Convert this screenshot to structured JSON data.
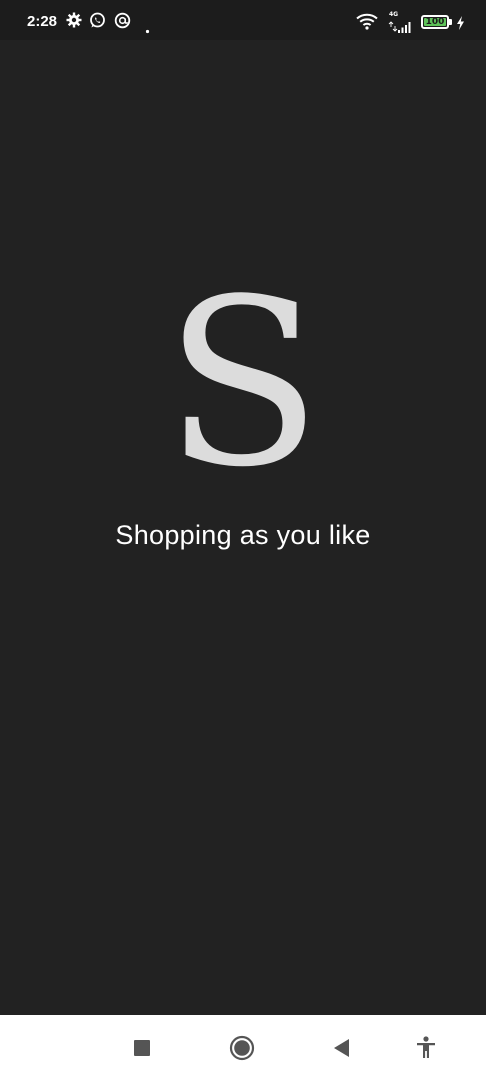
{
  "status_bar": {
    "time": "2:28",
    "network_type": "4G",
    "battery_level": "100",
    "icons": [
      "settings-icon",
      "whatsapp-icon",
      "at-sign-icon",
      "dot-icon",
      "wifi-icon",
      "signal-icon",
      "battery-icon",
      "charging-icon"
    ]
  },
  "splash": {
    "logo_letter": "S",
    "tagline": "Shopping as you like"
  },
  "nav_bar": {
    "icons": [
      "recents-icon",
      "home-icon",
      "back-icon",
      "accessibility-icon"
    ]
  },
  "colors": {
    "background": "#222222",
    "status_bar": "#1c1c1c",
    "logo": "#dcdcdc",
    "text": "#ffffff",
    "nav_bar": "#ffffff",
    "nav_icons": "#555555",
    "battery_fill": "#5fc35a"
  }
}
